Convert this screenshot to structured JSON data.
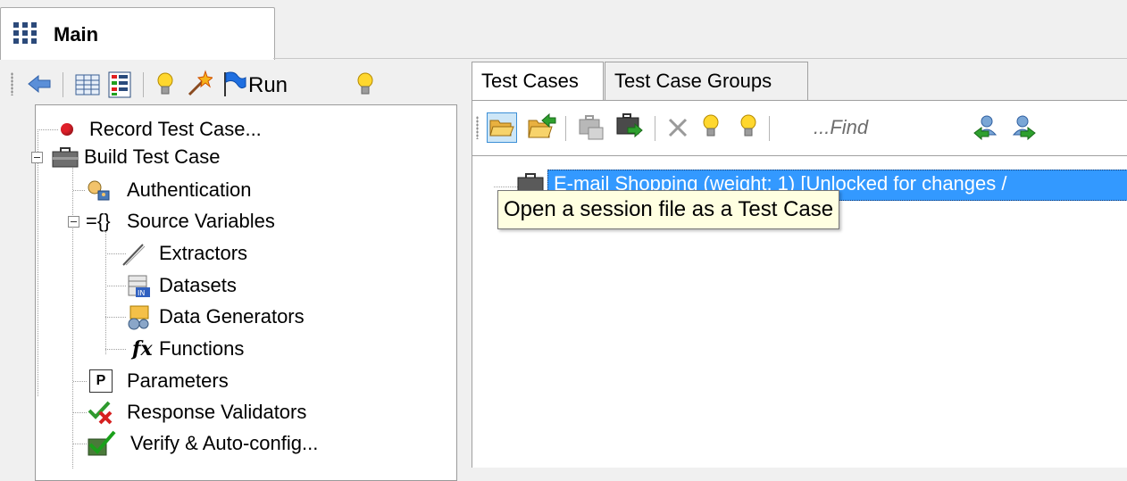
{
  "main_tab": {
    "title": "Main",
    "icon": "grid-icon"
  },
  "left_toolbar": {
    "run_label": "Run",
    "icons": [
      "back-arrow-icon",
      "table-icon",
      "colored-list-icon",
      "lightbulb-icon",
      "magic-wand-icon",
      "blue-flag-icon",
      "lightbulb-icon"
    ]
  },
  "tree": {
    "items": [
      {
        "label": "Record Test Case...",
        "icon": "record-dot-icon"
      },
      {
        "label": "Build Test Case",
        "icon": "briefcase-icon"
      },
      {
        "label": "Authentication",
        "icon": "user-key-icon"
      },
      {
        "label": "Source Variables",
        "icon": "braces-icon",
        "prefix": "={}"
      },
      {
        "label": "Extractors",
        "icon": "pipette-icon"
      },
      {
        "label": "Datasets",
        "icon": "dataset-icon"
      },
      {
        "label": "Data Generators",
        "icon": "data-generator-icon"
      },
      {
        "label": "Functions",
        "icon": "fx-icon",
        "icon_text": "fx"
      },
      {
        "label": "Parameters",
        "icon": "parameter-p-icon",
        "icon_text": "P"
      },
      {
        "label": "Response Validators",
        "icon": "validator-check-icon"
      },
      {
        "label": "Verify & Auto-config...",
        "icon": "verify-check-icon"
      }
    ]
  },
  "right_tabs": [
    {
      "label": "Test Cases",
      "active": true
    },
    {
      "label": "Test Case Groups",
      "active": false
    }
  ],
  "right_toolbar": {
    "find_placeholder": "...Find",
    "icons": [
      "open-folder-icon",
      "open-folder-arrow-icon",
      "briefcase-copy-icon",
      "briefcase-add-icon",
      "delete-x-icon",
      "lightbulb-icon",
      "lightbulb-icon",
      "find-user-back-icon",
      "find-user-next-icon"
    ]
  },
  "list": {
    "rows": [
      {
        "label": "E-mail Shopping  (weight: 1) [Unlocked for changes /",
        "selected": true
      }
    ]
  },
  "tooltip": {
    "text": "Open a session file as a Test Case"
  },
  "colors": {
    "selection": "#3399ff",
    "tooltip_bg": "#ffffe1",
    "record_dot": "#e0202a"
  }
}
